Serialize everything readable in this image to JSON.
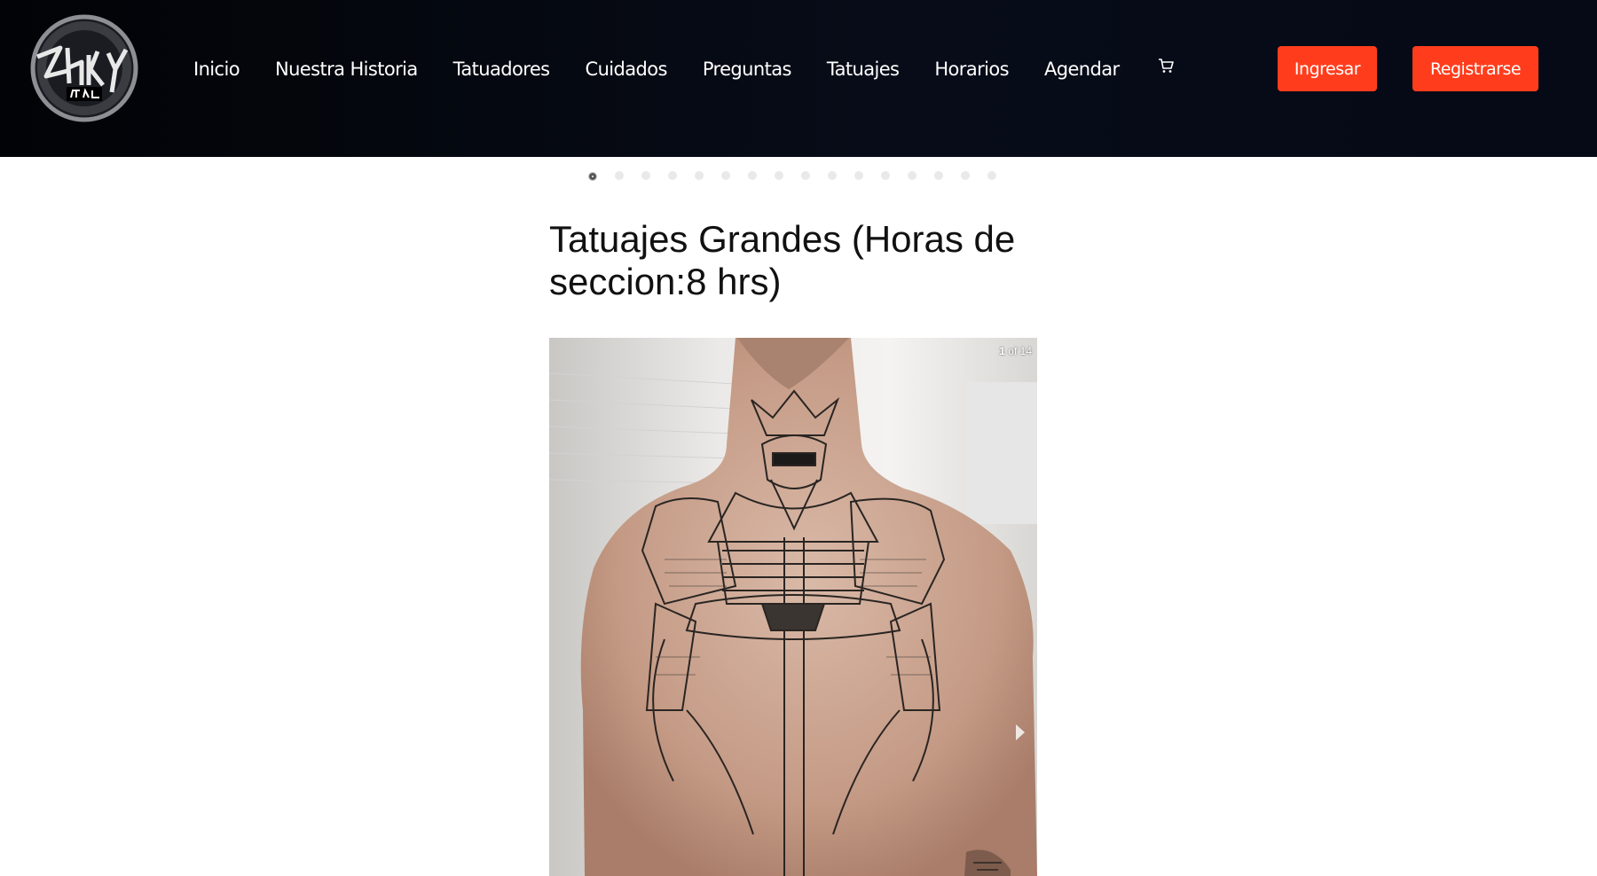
{
  "navbar": {
    "logo_alt": "Zhiky Tattoo",
    "links": [
      "Inicio",
      "Nuestra Historia",
      "Tatuadores",
      "Cuidados",
      "Preguntas",
      "Tatuajes",
      "Horarios",
      "Agendar"
    ],
    "cart_icon": "cart-icon",
    "login_label": "Ingresar",
    "register_label": "Registrarse",
    "accent_color": "#ff3d1c"
  },
  "carousel": {
    "dot_count": 16,
    "active_index": 0
  },
  "section": {
    "title": "Tatuajes Grandes (Horas de seccion:8 hrs)"
  },
  "gallery": {
    "counter_current": "1",
    "counter_text": "of 14",
    "image_alt": "back tattoo photo"
  }
}
